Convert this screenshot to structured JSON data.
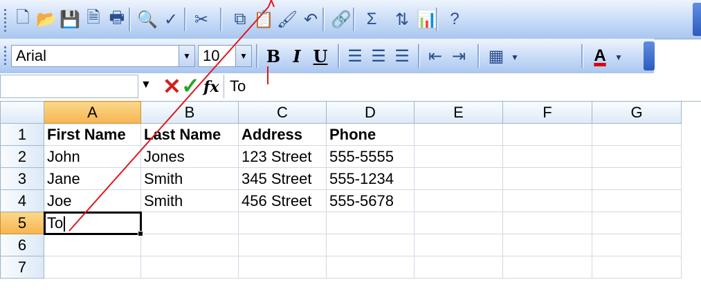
{
  "toolbar_standard": {
    "buttons": [
      {
        "name": "new-icon",
        "glyph": "🗋"
      },
      {
        "name": "open-icon",
        "glyph": "📂"
      },
      {
        "name": "save-icon",
        "glyph": "💾"
      },
      {
        "name": "permission-icon",
        "glyph": "🗎"
      },
      {
        "name": "print-icon",
        "glyph": "🖶"
      },
      {
        "name": "print-preview-icon",
        "glyph": "🔍"
      },
      {
        "name": "spelling-icon",
        "glyph": "✓"
      },
      {
        "name": "cut-icon",
        "glyph": "✂"
      },
      {
        "name": "copy-icon",
        "glyph": "⧉"
      },
      {
        "name": "paste-icon",
        "glyph": "📋"
      },
      {
        "name": "format-painter-icon",
        "glyph": "🖌"
      },
      {
        "name": "undo-icon",
        "glyph": "↶"
      },
      {
        "name": "hyperlink-icon",
        "glyph": "🔗"
      },
      {
        "name": "autosum-icon",
        "glyph": "Σ"
      },
      {
        "name": "sort-ascending-icon",
        "glyph": "⇅"
      },
      {
        "name": "chart-wizard-icon",
        "glyph": "📊"
      },
      {
        "name": "help-icon",
        "glyph": "?"
      }
    ]
  },
  "toolbar_formatting": {
    "font_name": "Arial",
    "font_size": "10",
    "bold_label": "B",
    "italic_label": "I",
    "underline_label": "U",
    "font_color_label": "A",
    "buttons": [
      {
        "name": "align-left-icon",
        "glyph": "☰"
      },
      {
        "name": "align-center-icon",
        "glyph": "☰"
      },
      {
        "name": "align-right-icon",
        "glyph": "☰"
      },
      {
        "name": "decrease-indent-icon",
        "glyph": "⇤"
      },
      {
        "name": "increase-indent-icon",
        "glyph": "⇥"
      },
      {
        "name": "borders-icon",
        "glyph": "▦"
      }
    ]
  },
  "formula_bar": {
    "name_box": "",
    "fx_label": "fx",
    "content": "To"
  },
  "columns": [
    "A",
    "B",
    "C",
    "D",
    "E",
    "F",
    "G"
  ],
  "rows": [
    {
      "num": "1",
      "cells": [
        "First Name",
        "Last Name",
        "Address",
        "Phone",
        "",
        "",
        ""
      ]
    },
    {
      "num": "2",
      "cells": [
        "John",
        "Jones",
        "123 Street",
        "555-5555",
        "",
        "",
        ""
      ]
    },
    {
      "num": "3",
      "cells": [
        "Jane",
        "Smith",
        "345 Street",
        "555-1234",
        "",
        "",
        ""
      ]
    },
    {
      "num": "4",
      "cells": [
        "Joe",
        "Smith",
        "456 Street",
        "555-5678",
        "",
        "",
        ""
      ]
    },
    {
      "num": "5",
      "cells": [
        "To",
        "",
        "",
        "",
        "",
        "",
        ""
      ]
    },
    {
      "num": "6",
      "cells": [
        "",
        "",
        "",
        "",
        "",
        "",
        ""
      ]
    },
    {
      "num": "7",
      "cells": [
        "",
        "",
        "",
        "",
        "",
        "",
        ""
      ]
    }
  ],
  "active_cell": {
    "column": "A",
    "row": "5"
  },
  "colors": {
    "annotation_line": "#e0161b",
    "selected_header": "#f7b450"
  }
}
